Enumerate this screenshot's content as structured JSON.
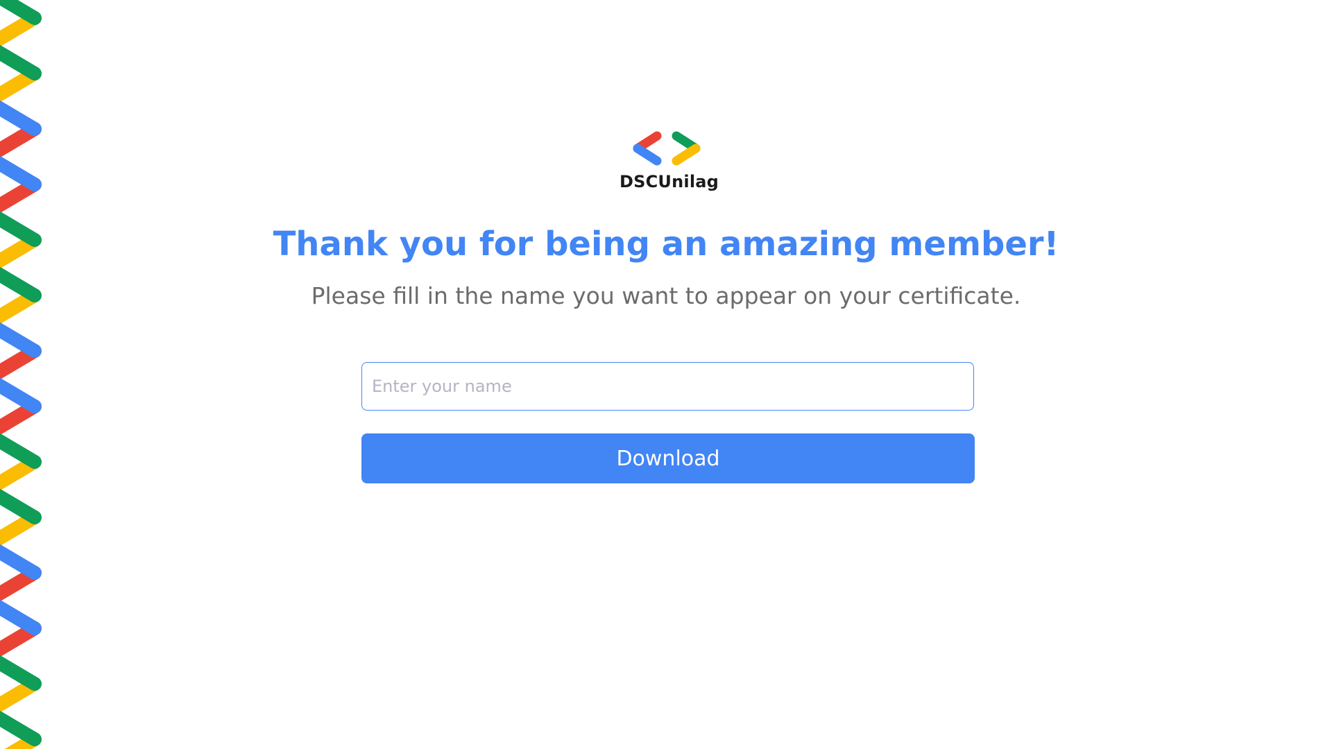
{
  "brand": {
    "name": "DSCUnilag",
    "logo_icon": "dsc-brackets-logo-icon",
    "colors": {
      "blue": "#4285f4",
      "red": "#ea4335",
      "yellow": "#fbbc04",
      "green": "#0f9d58"
    }
  },
  "main": {
    "headline": "Thank you for being an amazing member!",
    "subline": "Please fill in the name you want to appear on your certificate."
  },
  "form": {
    "name_placeholder": "Enter your name",
    "name_value": "",
    "download_label": "Download"
  },
  "decoration": {
    "icon": "chevron-stripe-pattern-icon",
    "pattern_colors": [
      [
        "#0f9d58",
        "#fbbc04"
      ],
      [
        "#0f9d58",
        "#fbbc04"
      ],
      [
        "#4285f4",
        "#ea4335"
      ],
      [
        "#4285f4",
        "#ea4335"
      ],
      [
        "#0f9d58",
        "#fbbc04"
      ],
      [
        "#0f9d58",
        "#fbbc04"
      ],
      [
        "#4285f4",
        "#ea4335"
      ],
      [
        "#4285f4",
        "#ea4335"
      ],
      [
        "#0f9d58",
        "#fbbc04"
      ],
      [
        "#0f9d58",
        "#fbbc04"
      ],
      [
        "#4285f4",
        "#ea4335"
      ],
      [
        "#4285f4",
        "#ea4335"
      ],
      [
        "#0f9d58",
        "#fbbc04"
      ],
      [
        "#0f9d58",
        "#fbbc04"
      ]
    ]
  }
}
